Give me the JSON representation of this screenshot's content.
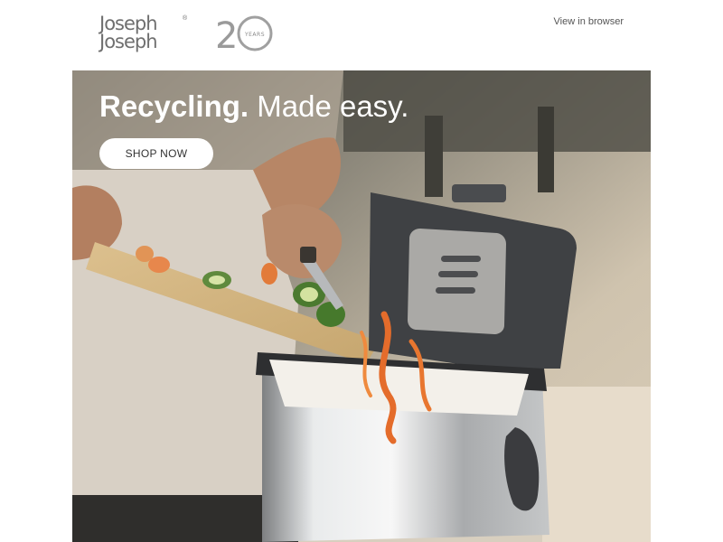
{
  "header": {
    "brand_line_1": "Joseph",
    "brand_line_2": "Joseph",
    "brand_registered_mark": "®",
    "anniversary_number": "20",
    "anniversary_label": "YEARS",
    "view_in_browser_label": "View in browser"
  },
  "hero": {
    "headline_bold": "Recycling.",
    "headline_light": "Made easy.",
    "cta_label": "SHOP NOW"
  },
  "colors": {
    "brand_grey": "#6f6f6f",
    "text_dark": "#333333",
    "white": "#ffffff"
  }
}
